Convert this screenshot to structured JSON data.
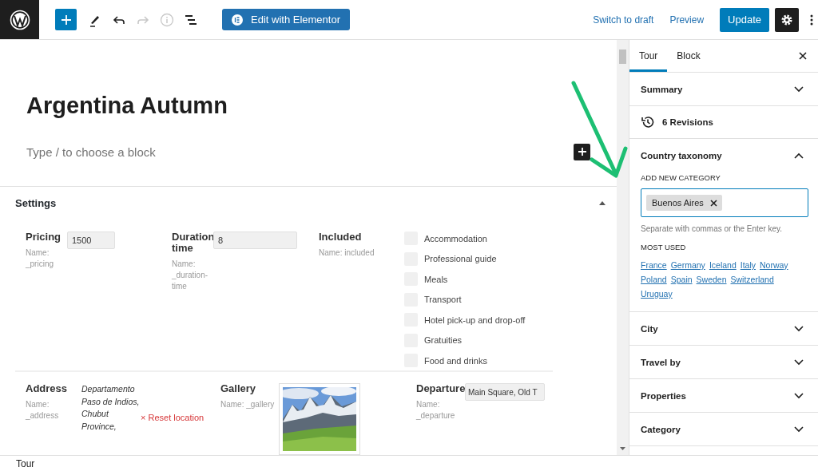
{
  "toolbar": {
    "edit_button": "Edit with Elementor",
    "switch_to_draft": "Switch to draft",
    "preview": "Preview",
    "update": "Update"
  },
  "post": {
    "title": "Argentina Autumn",
    "block_placeholder": "Type / to choose a block"
  },
  "settings": {
    "title": "Settings",
    "expanded": true,
    "fields": [
      {
        "kind": "text",
        "label": "Pricing",
        "name": "Name: _pricing",
        "value": "1500"
      },
      {
        "kind": "text",
        "label": "Duration time",
        "name": "Name: _duration-time",
        "value": "8"
      },
      {
        "kind": "checklist",
        "label": "Included",
        "name": "Name: included",
        "options": [
          {
            "label": "Accommodation",
            "checked": false
          },
          {
            "label": "Professional guide",
            "checked": false
          },
          {
            "label": "Meals",
            "checked": false
          },
          {
            "label": "Transport",
            "checked": false
          },
          {
            "label": "Hotel pick-up and drop-off",
            "checked": false
          },
          {
            "label": "Gratuities",
            "checked": false
          },
          {
            "label": "Food and drinks",
            "checked": false
          }
        ]
      }
    ],
    "fields_2": [
      {
        "kind": "address",
        "label": "Address",
        "name": "Name: _address",
        "value": "Departamento Paso de Indios, Chubut Province,",
        "reset": "× Reset location"
      },
      {
        "kind": "gallery",
        "label": "Gallery",
        "name": "Name: _gallery"
      },
      {
        "kind": "text",
        "label": "Departure",
        "name": "Name: _departure",
        "value": "Main Square, Old T"
      }
    ]
  },
  "sidebar": {
    "tabs": [
      {
        "label": "Tour",
        "selected": true
      },
      {
        "label": "Block",
        "selected": false
      }
    ],
    "panels": [
      {
        "kind": "panel",
        "title": "Summary",
        "expanded": false
      },
      {
        "kind": "revisions",
        "title": "6 Revisions"
      },
      {
        "kind": "panel",
        "title": "Country taxonomy",
        "expanded": true,
        "section_label": "ADD NEW CATEGORY",
        "tokens": [
          "Buenos Aires"
        ],
        "help": "Separate with commas or the Enter key.",
        "most_used_label": "MOST USED",
        "most_used": [
          "France",
          "Germany",
          "Iceland",
          "Italy",
          "Norway",
          "Poland",
          "Spain",
          "Sweden",
          "Switzerland",
          "Uruguay"
        ]
      },
      {
        "kind": "panel",
        "title": "City",
        "expanded": false
      },
      {
        "kind": "panel",
        "title": "Travel by",
        "expanded": false
      },
      {
        "kind": "panel",
        "title": "Properties",
        "expanded": false
      },
      {
        "kind": "panel",
        "title": "Category",
        "expanded": false
      }
    ]
  },
  "footer": {
    "breadcrumb": "Tour"
  }
}
